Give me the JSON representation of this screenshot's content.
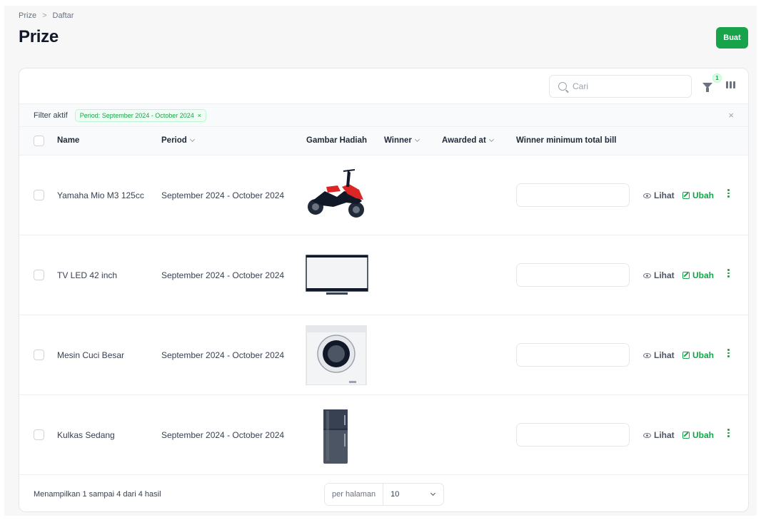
{
  "breadcrumb": {
    "root": "Prize",
    "separator": ">",
    "current": "Daftar"
  },
  "page": {
    "title": "Prize",
    "create_label": "Buat"
  },
  "toolbar": {
    "search_placeholder": "Cari",
    "filter_count": "1"
  },
  "filters": {
    "label": "Filter aktif",
    "chip": "Period: September 2024 - October 2024",
    "chip_remove": "×",
    "clear": "×"
  },
  "columns": {
    "name": "Name",
    "period": "Period",
    "image": "Gambar Hadiah",
    "winner": "Winner",
    "awarded_at": "Awarded at",
    "min_bill": "Winner minimum total bill"
  },
  "actions": {
    "view": "Lihat",
    "edit": "Ubah"
  },
  "rows": [
    {
      "name": "Yamaha Mio M3 125cc",
      "period": "September 2024 - October 2024",
      "image": "motorcycle"
    },
    {
      "name": "TV LED 42 inch",
      "period": "September 2024 - October 2024",
      "image": "television"
    },
    {
      "name": "Mesin Cuci Besar",
      "period": "September 2024 - October 2024",
      "image": "washing-machine"
    },
    {
      "name": "Kulkas Sedang",
      "period": "September 2024 - October 2024",
      "image": "refrigerator"
    }
  ],
  "footer": {
    "summary": "Menampilkan 1 sampai 4 dari 4 hasil",
    "per_page_label": "per halaman",
    "per_page_value": "10"
  },
  "colors": {
    "accent": "#16a34a",
    "background": "#f7f7f7"
  }
}
